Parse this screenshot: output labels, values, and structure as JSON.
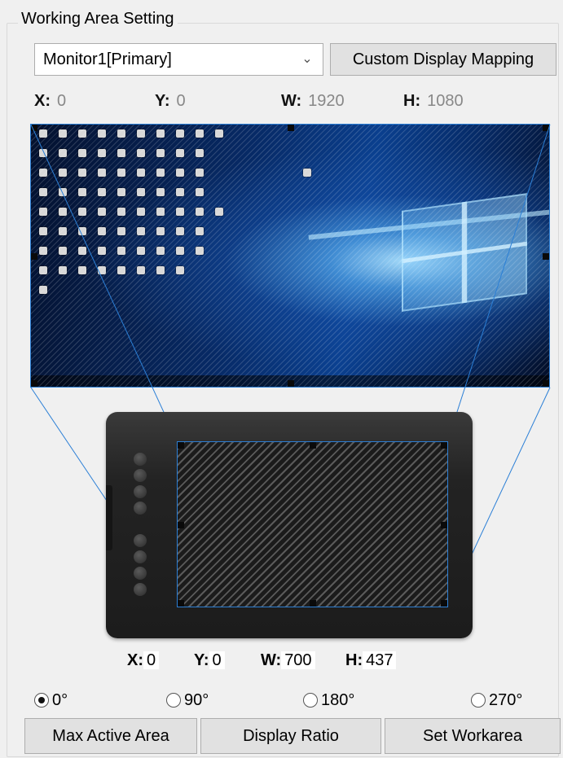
{
  "group_title": "Working Area Setting",
  "monitor_select": {
    "value": "Monitor1[Primary]",
    "chevron": "chevron-down-icon"
  },
  "custom_mapping_button": "Custom Display Mapping",
  "screen_area": {
    "x_label": "X:",
    "x_value": "0",
    "y_label": "Y:",
    "y_value": "0",
    "w_label": "W:",
    "w_value": "1920",
    "h_label": "H:",
    "h_value": "1080"
  },
  "tablet_area": {
    "x_label": "X:",
    "x_value": "0",
    "y_label": "Y:",
    "y_value": "0",
    "w_label": "W:",
    "w_value": "700",
    "h_label": "H:",
    "h_value": "437"
  },
  "rotation": {
    "options": [
      "0°",
      "90°",
      "180°",
      "270°"
    ],
    "selected": "0°"
  },
  "buttons": {
    "max_active_area": "Max Active Area",
    "display_ratio": "Display Ratio",
    "set_workarea": "Set Workarea"
  },
  "colors": {
    "accent": "#2b7fd6",
    "background": "#f0f0f0"
  }
}
